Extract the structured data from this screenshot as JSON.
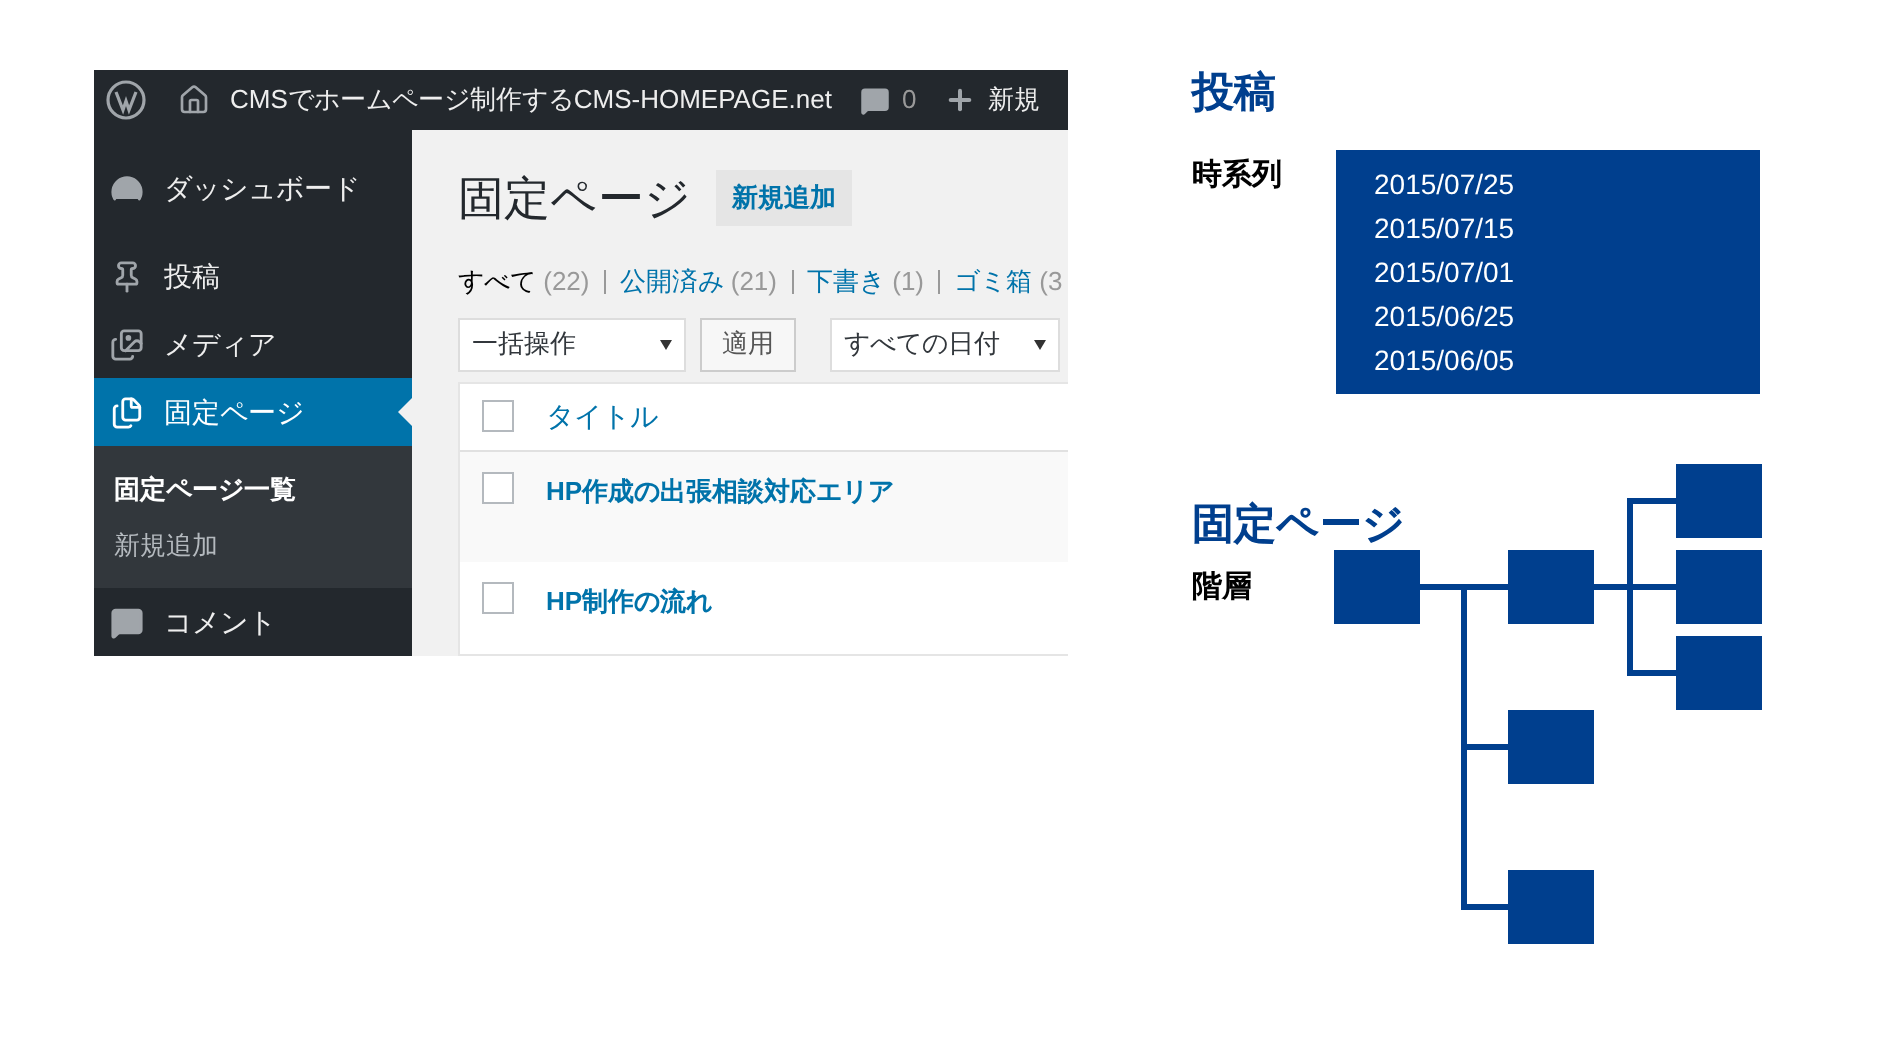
{
  "admin_bar": {
    "site_name": "CMSでホームページ制作するCMS-HOMEPAGE.net",
    "comments_count": "0",
    "new_label": "新規"
  },
  "sidebar": {
    "items": [
      {
        "label": "ダッシュボード",
        "selected": false
      },
      {
        "label": "投稿",
        "selected": false
      },
      {
        "label": "メディア",
        "selected": false
      },
      {
        "label": "固定ページ",
        "selected": true,
        "submenu": [
          {
            "label": "固定ページ一覧",
            "selected": true
          },
          {
            "label": "新規追加",
            "selected": false
          }
        ]
      },
      {
        "label": "コメント",
        "selected": false
      }
    ]
  },
  "page": {
    "title": "固定ページ",
    "add_new": "新規追加",
    "filters": [
      {
        "label": "すべて",
        "count": "(22)",
        "selected": true
      },
      {
        "label": "公開済み",
        "count": "(21)",
        "selected": false
      },
      {
        "label": "下書き",
        "count": "(1)",
        "selected": false
      },
      {
        "label": "ゴミ箱",
        "count": "(3",
        "selected": false
      }
    ],
    "bulk_select": "一括操作",
    "apply_button": "適用",
    "date_select": "すべての日付",
    "table": {
      "header": "タイトル",
      "header_checked": false,
      "rows": [
        {
          "title": "HP作成の出張相談対応エリア",
          "checked": false
        },
        {
          "title": "HP制作の流れ",
          "checked": false
        }
      ]
    }
  },
  "posts_section": {
    "heading": "投稿",
    "label": "時系列",
    "dates": [
      "2015/07/25",
      "2015/07/15",
      "2015/07/01",
      "2015/06/25",
      "2015/06/05"
    ]
  },
  "pages_section": {
    "heading": "固定ページ",
    "label": "階層"
  }
}
